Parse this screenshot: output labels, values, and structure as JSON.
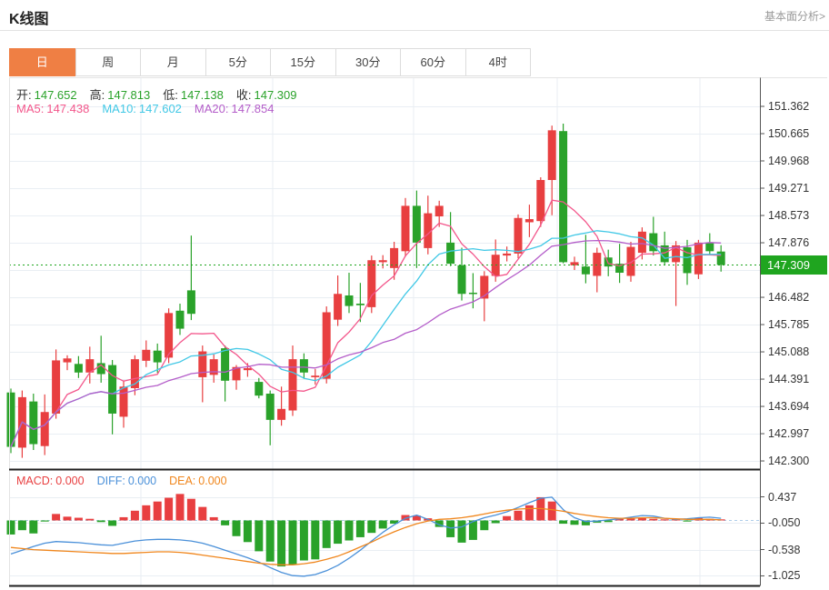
{
  "header": {
    "title": "K线图",
    "more_link": "基本面分析>"
  },
  "toolbar": {
    "tabs": [
      "日",
      "周",
      "月",
      "5分",
      "15分",
      "30分",
      "60分",
      "4时"
    ],
    "selected_index": 0
  },
  "legend": {
    "ohlc": [
      {
        "label": "开:",
        "value": "147.652"
      },
      {
        "label": "高:",
        "value": "147.813"
      },
      {
        "label": "低:",
        "value": "147.138"
      },
      {
        "label": "收:",
        "value": "147.309"
      }
    ],
    "ma": [
      {
        "label": "MA5:",
        "value": "147.438"
      },
      {
        "label": "MA10:",
        "value": "147.602"
      },
      {
        "label": "MA20:",
        "value": "147.854"
      }
    ],
    "macd": [
      {
        "label": "MACD:",
        "value": "0.000"
      },
      {
        "label": "DIFF:",
        "value": "0.000"
      },
      {
        "label": "DEA:",
        "value": "0.000"
      }
    ]
  },
  "axis": {
    "price_ticks": [
      151.362,
      150.665,
      149.968,
      149.271,
      148.573,
      147.876,
      146.482,
      145.785,
      145.088,
      144.391,
      143.694,
      142.997,
      142.3
    ],
    "current_price": "147.309",
    "macd_ticks": [
      0.437,
      -0.05,
      -0.538,
      -1.025
    ]
  },
  "colors": {
    "up": "#e83f40",
    "down": "#2aa22a",
    "badge": "#1fa51f",
    "tab_accent": "#ef7f44",
    "ma5": "#f3568b",
    "ma10": "#41c8e6",
    "ma20": "#b45dc9",
    "macd_label": "#e83f40",
    "diff": "#4a90d9",
    "dea": "#f0861c",
    "grid": "#e9eef3",
    "axis_line": "#555555",
    "dark_rule": "#1f1f1f",
    "zero_dash": "#aecdea",
    "label": "#333333",
    "muted": "#999999",
    "border": "#e4e4e4"
  },
  "chart_data": [
    {
      "type": "candlestick",
      "title": "K线图 (日)",
      "grid_prices": [
        151.362,
        150.665,
        149.968,
        149.271,
        148.573,
        147.876,
        147.179,
        146.482,
        145.785,
        145.088,
        144.391,
        143.694,
        142.997,
        142.3
      ],
      "last_price": 147.309,
      "ma_periods": [
        5,
        10,
        20
      ],
      "legend_note": "红=涨 绿=跌",
      "candles": [
        [
          144.05,
          144.15,
          142.5,
          142.66
        ],
        [
          142.64,
          144.1,
          142.38,
          143.93
        ],
        [
          143.82,
          144.02,
          142.58,
          142.73
        ],
        [
          142.68,
          144.0,
          142.45,
          143.55
        ],
        [
          143.51,
          145.15,
          143.38,
          144.87
        ],
        [
          144.82,
          145.0,
          144.62,
          144.92
        ],
        [
          144.78,
          144.98,
          144.42,
          144.56
        ],
        [
          144.56,
          145.22,
          144.28,
          144.9
        ],
        [
          144.8,
          145.5,
          144.3,
          144.52
        ],
        [
          144.75,
          144.88,
          142.98,
          143.51
        ],
        [
          143.43,
          144.36,
          143.15,
          144.2
        ],
        [
          144.16,
          145.0,
          143.98,
          144.9
        ],
        [
          144.86,
          145.38,
          144.7,
          145.14
        ],
        [
          145.12,
          145.3,
          144.55,
          144.82
        ],
        [
          144.94,
          146.2,
          144.8,
          146.08
        ],
        [
          146.14,
          146.32,
          145.52,
          145.68
        ],
        [
          146.66,
          148.06,
          145.9,
          146.06
        ],
        [
          144.44,
          145.25,
          143.8,
          145.1
        ],
        [
          144.5,
          145.02,
          144.3,
          144.9
        ],
        [
          145.18,
          145.25,
          143.82,
          144.35
        ],
        [
          144.36,
          144.75,
          144.12,
          144.7
        ],
        [
          144.62,
          144.8,
          144.45,
          144.67
        ],
        [
          144.32,
          144.42,
          143.9,
          143.97
        ],
        [
          144.02,
          144.1,
          142.7,
          143.35
        ],
        [
          143.35,
          144.2,
          143.2,
          143.63
        ],
        [
          143.59,
          145.25,
          143.45,
          144.9
        ],
        [
          144.9,
          145.05,
          144.4,
          144.56
        ],
        [
          144.44,
          144.65,
          144.25,
          144.48
        ],
        [
          144.4,
          146.25,
          144.28,
          146.1
        ],
        [
          145.91,
          147.04,
          145.75,
          146.57
        ],
        [
          146.53,
          147.11,
          146.08,
          146.26
        ],
        [
          146.32,
          146.85,
          145.85,
          146.28
        ],
        [
          146.23,
          147.55,
          146.08,
          147.43
        ],
        [
          147.38,
          147.56,
          147.22,
          147.43
        ],
        [
          147.23,
          147.9,
          146.93,
          147.74
        ],
        [
          147.66,
          149.02,
          147.52,
          148.82
        ],
        [
          148.82,
          149.21,
          147.23,
          147.88
        ],
        [
          147.74,
          149.08,
          147.58,
          148.63
        ],
        [
          148.55,
          148.95,
          148.28,
          148.82
        ],
        [
          147.88,
          148.66,
          147.28,
          147.34
        ],
        [
          147.3,
          147.75,
          146.4,
          146.57
        ],
        [
          146.6,
          147.1,
          146.2,
          146.57
        ],
        [
          146.45,
          147.15,
          145.87,
          147.03
        ],
        [
          147.03,
          147.96,
          146.88,
          147.57
        ],
        [
          147.55,
          147.78,
          147.4,
          147.6
        ],
        [
          147.6,
          148.6,
          147.48,
          148.51
        ],
        [
          148.4,
          148.85,
          148.02,
          148.48
        ],
        [
          148.43,
          149.55,
          148.28,
          149.48
        ],
        [
          149.48,
          150.87,
          148.58,
          150.75
        ],
        [
          150.73,
          150.92,
          147.35,
          147.38
        ],
        [
          147.3,
          147.52,
          147.18,
          147.38
        ],
        [
          147.27,
          148.08,
          146.84,
          147.07
        ],
        [
          147.03,
          147.75,
          146.61,
          147.62
        ],
        [
          147.5,
          147.7,
          147.02,
          147.27
        ],
        [
          147.34,
          147.85,
          146.85,
          147.11
        ],
        [
          147.03,
          147.9,
          146.88,
          147.77
        ],
        [
          147.62,
          148.27,
          147.45,
          148.16
        ],
        [
          148.12,
          148.54,
          147.55,
          147.66
        ],
        [
          147.81,
          148.16,
          147.3,
          147.38
        ],
        [
          147.38,
          147.92,
          146.26,
          147.81
        ],
        [
          147.76,
          147.95,
          146.8,
          147.1
        ],
        [
          147.07,
          147.95,
          146.95,
          147.88
        ],
        [
          147.88,
          148.12,
          147.58,
          147.66
        ],
        [
          147.652,
          147.813,
          147.138,
          147.309
        ]
      ]
    },
    {
      "type": "bar+line",
      "name": "MACD",
      "y_ticks": [
        0.437,
        -0.05,
        -0.538,
        -1.025
      ],
      "histogram": [
        -0.26,
        -0.18,
        -0.24,
        -0.02,
        0.12,
        0.07,
        0.05,
        0.03,
        -0.03,
        -0.1,
        0.06,
        0.18,
        0.28,
        0.35,
        0.42,
        0.49,
        0.4,
        0.25,
        0.06,
        -0.09,
        -0.29,
        -0.4,
        -0.57,
        -0.76,
        -0.85,
        -0.82,
        -0.74,
        -0.72,
        -0.51,
        -0.43,
        -0.37,
        -0.31,
        -0.23,
        -0.15,
        -0.06,
        0.1,
        0.09,
        0.04,
        -0.12,
        -0.31,
        -0.41,
        -0.36,
        -0.18,
        -0.05,
        0.08,
        0.18,
        0.28,
        0.43,
        0.35,
        -0.06,
        -0.08,
        -0.09,
        -0.04,
        -0.03,
        0.03,
        0.04,
        0.05,
        0.03,
        0.02,
        0.01,
        -0.01,
        0.05,
        0.03,
        0.02
      ],
      "diff": [
        -0.62,
        -0.55,
        -0.48,
        -0.42,
        -0.39,
        -0.4,
        -0.41,
        -0.43,
        -0.45,
        -0.46,
        -0.42,
        -0.38,
        -0.36,
        -0.35,
        -0.35,
        -0.36,
        -0.38,
        -0.42,
        -0.48,
        -0.55,
        -0.62,
        -0.69,
        -0.77,
        -0.87,
        -0.96,
        -1.02,
        -1.03,
        -1.0,
        -0.93,
        -0.83,
        -0.7,
        -0.55,
        -0.38,
        -0.22,
        -0.08,
        0.04,
        0.1,
        0.02,
        -0.08,
        -0.14,
        -0.12,
        -0.02,
        0.05,
        0.1,
        0.16,
        0.24,
        0.33,
        0.41,
        0.43,
        0.2,
        0.05,
        -0.02,
        -0.01,
        0.01,
        0.03,
        0.06,
        0.09,
        0.08,
        0.04,
        0.02,
        0.03,
        0.05,
        0.06,
        0.04
      ],
      "dea": [
        -0.5,
        -0.52,
        -0.54,
        -0.55,
        -0.56,
        -0.57,
        -0.58,
        -0.59,
        -0.6,
        -0.61,
        -0.61,
        -0.6,
        -0.59,
        -0.58,
        -0.58,
        -0.59,
        -0.61,
        -0.64,
        -0.67,
        -0.7,
        -0.73,
        -0.76,
        -0.79,
        -0.81,
        -0.82,
        -0.82,
        -0.8,
        -0.77,
        -0.72,
        -0.66,
        -0.58,
        -0.49,
        -0.4,
        -0.3,
        -0.21,
        -0.13,
        -0.06,
        -0.01,
        0.02,
        0.03,
        0.05,
        0.08,
        0.12,
        0.16,
        0.19,
        0.21,
        0.22,
        0.22,
        0.2,
        0.17,
        0.13,
        0.1,
        0.07,
        0.05,
        0.04,
        0.04,
        0.05,
        0.05,
        0.04,
        0.03,
        0.02,
        0.02,
        0.02,
        0.01
      ]
    }
  ]
}
